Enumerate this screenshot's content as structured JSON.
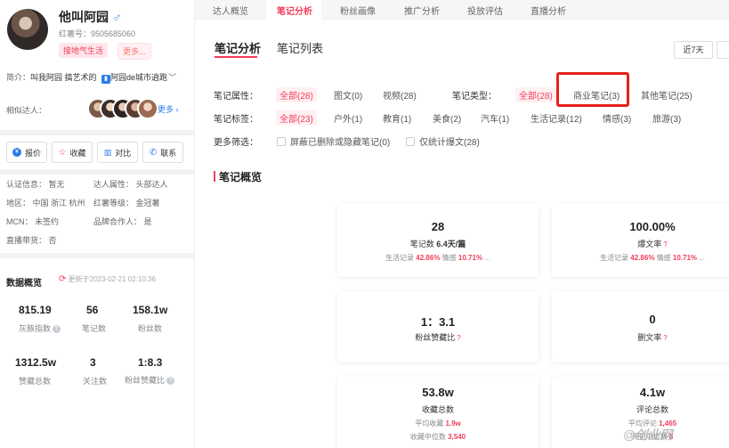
{
  "profile": {
    "name": "他叫阿园",
    "gender_icon": "♂",
    "redbook_id": "红薯号：9505685060",
    "tag_primary": "接地气生活",
    "tag_more": "更多...",
    "intro_label": "简介：",
    "intro_text": "叫我阿园 搞艺术的",
    "intro_link": "阿园de城市逍跑",
    "similar_label": "相似达人：",
    "similar_more": "更多",
    "buttons": {
      "report": "报价",
      "favorite": "收藏",
      "compare": "对比",
      "contact": "联系"
    },
    "auth": "认证信息：  暂无",
    "attr": "达人属性：  头部达人",
    "region": "地区：  中国 浙江 杭州",
    "level": "红薯等级：  金冠薯",
    "mcn": "MCN：  未签约",
    "brand": "品牌合作人：  是",
    "live": "直播带货：  否"
  },
  "overview": {
    "title": "数据概览",
    "updated": "更新于2023-02-21 02:10:36",
    "stats": [
      {
        "value": "815.19",
        "label": "灰豚指数"
      },
      {
        "value": "56",
        "label": "笔记数"
      },
      {
        "value": "158.1w",
        "label": "粉丝数"
      },
      {
        "value": "1312.5w",
        "label": "赞藏总数"
      },
      {
        "value": "3",
        "label": "关注数"
      },
      {
        "value": "1:8.3",
        "label": "粉丝赞藏比"
      }
    ]
  },
  "nav": {
    "tabs": [
      "达人概览",
      "笔记分析",
      "粉丝画像",
      "推广分析",
      "投放评估",
      "直播分析"
    ],
    "active": "笔记分析"
  },
  "subtabs": {
    "analysis": "笔记分析",
    "list": "笔记列表",
    "period": "近7天"
  },
  "filters": {
    "attr_label": "笔记属性：",
    "attr_options": [
      "全部(28)",
      "图文(0)",
      "视频(28)"
    ],
    "type_label": "笔记类型：",
    "type_options": [
      "全部(28)",
      "商业笔记(3)",
      "其他笔记(25)"
    ],
    "tag_label": "笔记标签：",
    "tag_options": [
      "全部(23)",
      "户外(1)",
      "教育(1)",
      "美食(2)",
      "汽车(1)",
      "生活记录(12)",
      "情感(3)",
      "旅游(3)"
    ],
    "more_label": "更多筛选：",
    "check1": "屏蔽已删除或隐藏笔记(0)",
    "check2": "仅统计爆文(28)"
  },
  "section": {
    "title": "笔记概览"
  },
  "cards": [
    {
      "value": "28",
      "label": "笔记数",
      "extra": "6.4天/篇",
      "sub_pre": "生活记录 ",
      "sub_hl1": "42.86%",
      "sub_mid": " 情感 ",
      "sub_hl2": "10.71%",
      "sub_end": " ..."
    },
    {
      "value": "100.00%",
      "label": "爆文率",
      "sub_pre": "生活记录 ",
      "sub_hl1": "42.86%",
      "sub_mid": " 情感 ",
      "sub_hl2": "10.71%",
      "sub_end": " ..."
    },
    {
      "value": "1：3.1",
      "label": "粉丝赞藏比"
    },
    {
      "value": "0",
      "label": "删文率"
    },
    {
      "value": "53.8w",
      "label": "收藏总数",
      "line1_pre": "平均收藏 ",
      "line1_hl": "1.9w",
      "line2_pre": "收藏中位数 ",
      "line2_hl": "3,540"
    },
    {
      "value": "4.1w",
      "label": "评论总数",
      "line1_pre": "平均评论 ",
      "line1_hl": "1,465",
      "line2_pre": "评论中位数 ",
      "line2_hl": "8"
    }
  ],
  "watermark": "@创业网",
  "colors": {
    "accent": "#f23d5c",
    "highlight_box": "#e8201c"
  }
}
